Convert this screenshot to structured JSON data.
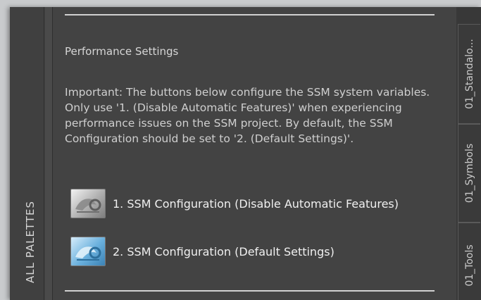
{
  "sidebar": {
    "label": "ALL PALETTES"
  },
  "panel": {
    "section_title": "Performance Settings",
    "note": "Important: The buttons below configure the SSM system variables. Only use '1. (Disable Automatic Features)' when experiencing performance issues on the SSM project. By default, the SSM Configuration should be set to '2. (Default Settings)'.",
    "commands": [
      {
        "label": "1. SSM Configuration (Disable Automatic Features)",
        "icon": "ssm-config-gray-icon"
      },
      {
        "label": "2. SSM Configuration (Default Settings)",
        "icon": "ssm-config-blue-icon"
      }
    ]
  },
  "tabs": [
    {
      "label": "01_Standalo..."
    },
    {
      "label": "01_Symbols"
    },
    {
      "label": "01_Tools"
    }
  ]
}
